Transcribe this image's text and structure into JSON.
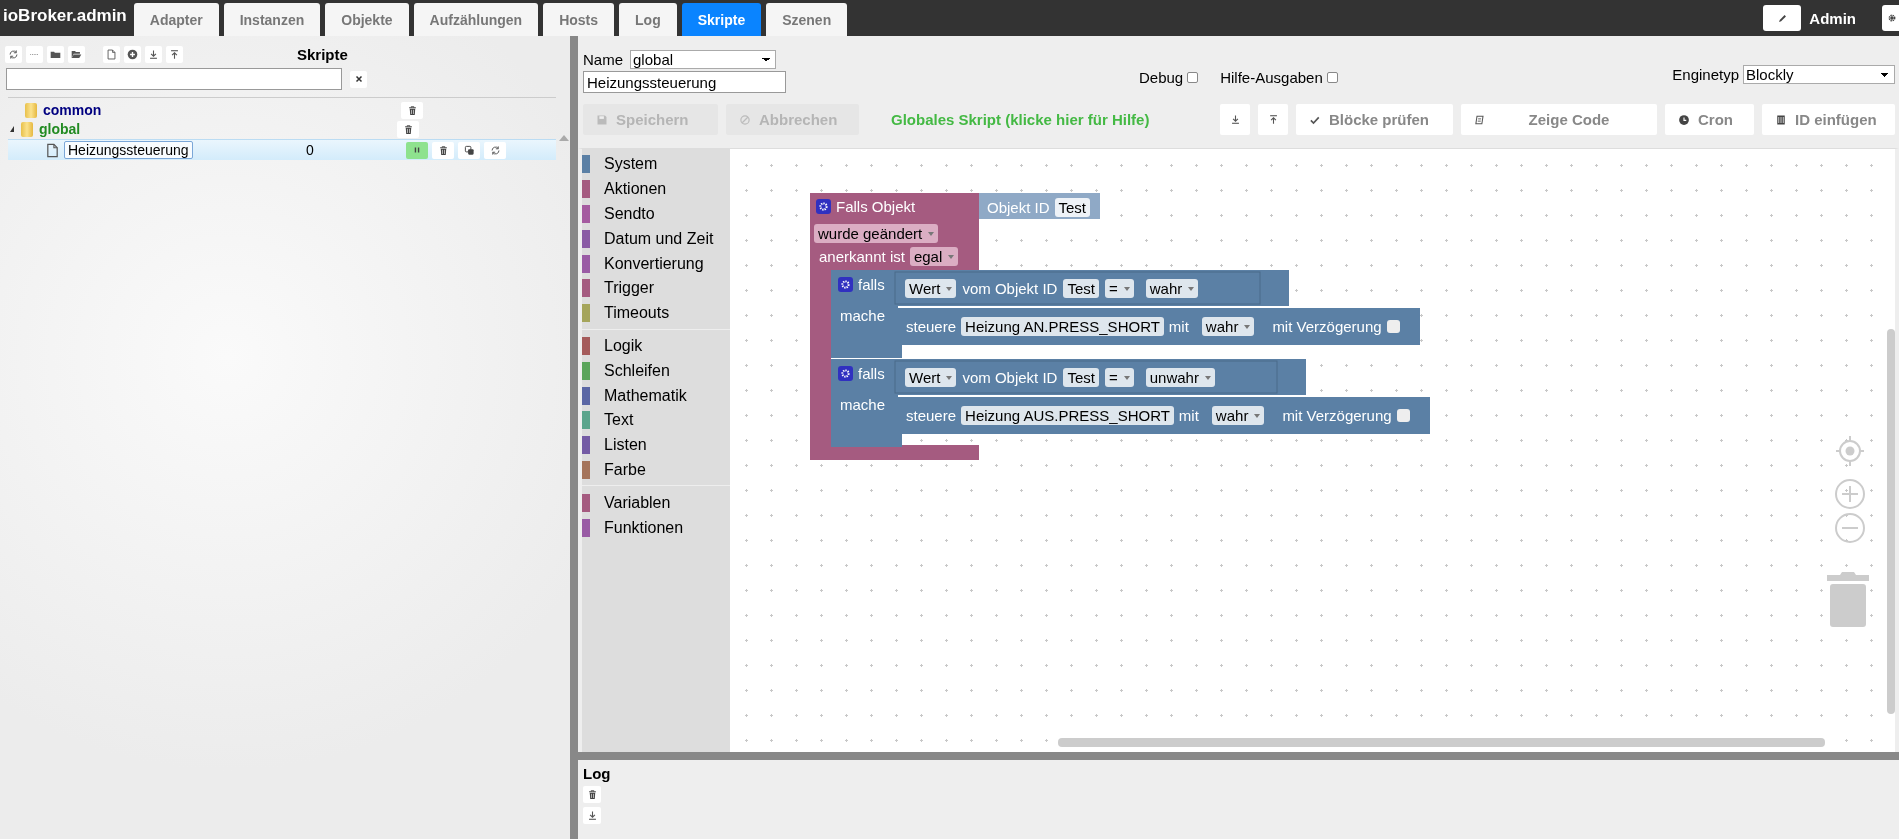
{
  "app_title": "ioBroker.admin",
  "tabs": [
    {
      "label": "Adapter",
      "selected": false
    },
    {
      "label": "Instanzen",
      "selected": false
    },
    {
      "label": "Objekte",
      "selected": false
    },
    {
      "label": "Aufzählungen",
      "selected": false
    },
    {
      "label": "Hosts",
      "selected": false
    },
    {
      "label": "Log",
      "selected": false
    },
    {
      "label": "Skripte",
      "selected": true
    },
    {
      "label": "Szenen",
      "selected": false
    }
  ],
  "user": {
    "name": "Admin"
  },
  "scripts_panel": {
    "title": "Skripte",
    "tree": [
      {
        "label": "common",
        "color": "#000080"
      },
      {
        "label": "global",
        "color": "#228b22",
        "expanded": true,
        "children": [
          {
            "label": "Heizungssteuerung",
            "count": "0",
            "selected": true,
            "enabled": true
          }
        ]
      }
    ]
  },
  "editor": {
    "name_label": "Name",
    "group": "global",
    "script_name": "Heizungssteuerung",
    "debug": {
      "label": "Debug",
      "checked": false
    },
    "help_output": {
      "label": "Hilfe-Ausgaben",
      "checked": false
    },
    "engine_label": "Enginetyp",
    "engine": "Blockly",
    "actions": [
      {
        "kind": "save",
        "label": "Speichern",
        "disabled": true
      },
      {
        "kind": "cancel",
        "label": "Abbrechen",
        "disabled": true
      }
    ],
    "hint": "Globales Skript (klicke hier für Hilfe)",
    "tools": [
      {
        "kind": "download",
        "disabled": false
      },
      {
        "kind": "upload",
        "disabled": false
      },
      {
        "kind": "check",
        "label": "Blöcke prüfen",
        "disabled": false
      },
      {
        "kind": "code",
        "label": "Zeige Code",
        "disabled": false
      },
      {
        "kind": "clock",
        "label": "Cron",
        "disabled": false
      },
      {
        "kind": "id",
        "label": "ID einfügen",
        "disabled": false
      }
    ]
  },
  "toolbox": [
    [
      {
        "label": "System",
        "color": "#5b80a5"
      },
      {
        "label": "Aktionen",
        "color": "#a55b80"
      },
      {
        "label": "Sendto",
        "color": "#a55ba0"
      },
      {
        "label": "Datum und Zeit",
        "color": "#8a5ba5"
      },
      {
        "label": "Konvertierung",
        "color": "#9a5ba5"
      },
      {
        "label": "Trigger",
        "color": "#a55b80"
      },
      {
        "label": "Timeouts",
        "color": "#a5a55b"
      }
    ],
    [
      {
        "label": "Logik",
        "color": "#a55b5b"
      },
      {
        "label": "Schleifen",
        "color": "#5ba55b"
      },
      {
        "label": "Mathematik",
        "color": "#5b67a5"
      },
      {
        "label": "Text",
        "color": "#5ba58c"
      },
      {
        "label": "Listen",
        "color": "#745ba5"
      },
      {
        "label": "Farbe",
        "color": "#a5745b"
      }
    ],
    [
      {
        "label": "Variablen",
        "color": "#a55b80"
      },
      {
        "label": "Funktionen",
        "color": "#995ba5"
      }
    ]
  ],
  "trigger": {
    "title": "Falls Objekt",
    "object_label": "Objekt ID",
    "object_id": "Test",
    "event": "wurde geändert",
    "ack_label": "anerkannt ist",
    "ack": "egal",
    "branches": [
      {
        "if_label": "falls",
        "do_label": "mache",
        "attr": "Wert",
        "of_label": "vom Objekt ID",
        "object_id": "Test",
        "op": "=",
        "value": "wahr",
        "action": "steuere",
        "target": "Heizung AN.PRESS_SHORT",
        "with_label": "mit",
        "set_value": "wahr",
        "delay_label": "mit Verzögerung",
        "delay": false
      },
      {
        "if_label": "falls",
        "do_label": "mache",
        "attr": "Wert",
        "of_label": "vom Objekt ID",
        "object_id": "Test",
        "op": "=",
        "value": "unwahr",
        "action": "steuere",
        "target": "Heizung AUS.PRESS_SHORT",
        "with_label": "mit",
        "set_value": "wahr",
        "delay_label": "mit Verzögerung",
        "delay": false
      }
    ]
  },
  "log": {
    "title": "Log"
  }
}
